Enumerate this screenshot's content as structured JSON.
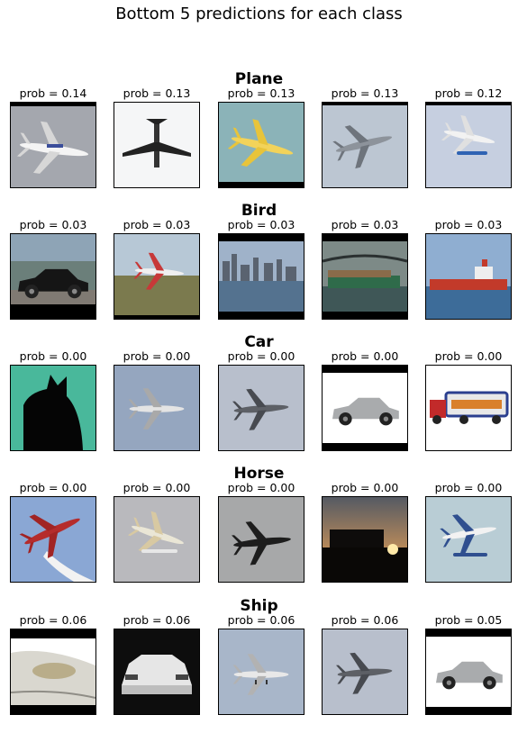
{
  "title": "Bottom 5 predictions for each class",
  "rows": [
    {
      "label": "Plane",
      "items": [
        {
          "caption": "prob = 0.14",
          "thumb": "airliner-gray-sky-icon"
        },
        {
          "caption": "prob = 0.13",
          "thumb": "airliner-white-sky-icon"
        },
        {
          "caption": "prob = 0.13",
          "thumb": "yellow-propplane-icon"
        },
        {
          "caption": "prob = 0.13",
          "thumb": "airliner-climb-icon"
        },
        {
          "caption": "prob = 0.12",
          "thumb": "seaplane-icon"
        }
      ]
    },
    {
      "label": "Bird",
      "items": [
        {
          "caption": "prob = 0.03",
          "thumb": "black-car-icon"
        },
        {
          "caption": "prob = 0.03",
          "thumb": "seaplane-on-grass-icon"
        },
        {
          "caption": "prob = 0.03",
          "thumb": "city-harbor-icon"
        },
        {
          "caption": "prob = 0.03",
          "thumb": "cargo-ship-bridge-icon"
        },
        {
          "caption": "prob = 0.03",
          "thumb": "red-tanker-ship-icon"
        }
      ]
    },
    {
      "label": "Car",
      "items": [
        {
          "caption": "prob = 0.00",
          "thumb": "black-cat-icon"
        },
        {
          "caption": "prob = 0.00",
          "thumb": "airliner-blue-sky-icon"
        },
        {
          "caption": "prob = 0.00",
          "thumb": "twin-prop-plane-icon"
        },
        {
          "caption": "prob = 0.00",
          "thumb": "silver-sportscar-icon"
        },
        {
          "caption": "prob = 0.00",
          "thumb": "truck-trailer-icon"
        }
      ]
    },
    {
      "label": "Horse",
      "items": [
        {
          "caption": "prob = 0.00",
          "thumb": "red-stunt-plane-icon"
        },
        {
          "caption": "prob = 0.00",
          "thumb": "floatplane-icon"
        },
        {
          "caption": "prob = 0.00",
          "thumb": "bomber-silhouette-icon"
        },
        {
          "caption": "prob = 0.00",
          "thumb": "sunset-truck-icon"
        },
        {
          "caption": "prob = 0.00",
          "thumb": "blue-seaplane-icon"
        }
      ]
    },
    {
      "label": "Ship",
      "items": [
        {
          "caption": "prob = 0.06",
          "thumb": "car-headlight-icon"
        },
        {
          "caption": "prob = 0.06",
          "thumb": "white-sportscar-front-icon"
        },
        {
          "caption": "prob = 0.06",
          "thumb": "airliner-landing-icon"
        },
        {
          "caption": "prob = 0.06",
          "thumb": "twin-prop-plane-icon"
        },
        {
          "caption": "prob = 0.05",
          "thumb": "silver-sportscar-icon"
        }
      ]
    }
  ]
}
